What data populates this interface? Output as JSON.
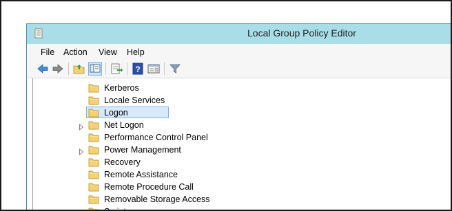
{
  "window": {
    "title": "Local Group Policy Editor"
  },
  "menu": {
    "items": [
      "File",
      "Action",
      "View",
      "Help"
    ]
  },
  "toolbar": {
    "buttons": [
      "back-icon",
      "forward-icon",
      "up-folder-icon",
      "show-hide-tree-icon",
      "export-list-icon",
      "help-icon",
      "properties-view-icon",
      "filter-icon"
    ]
  },
  "tree": {
    "items": [
      {
        "label": "Kerberos",
        "expandable": false,
        "selected": false
      },
      {
        "label": "Locale Services",
        "expandable": false,
        "selected": false
      },
      {
        "label": "Logon",
        "expandable": false,
        "selected": true
      },
      {
        "label": "Net Logon",
        "expandable": true,
        "selected": false
      },
      {
        "label": "Performance Control Panel",
        "expandable": false,
        "selected": false
      },
      {
        "label": "Power Management",
        "expandable": true,
        "selected": false
      },
      {
        "label": "Recovery",
        "expandable": false,
        "selected": false
      },
      {
        "label": "Remote Assistance",
        "expandable": false,
        "selected": false
      },
      {
        "label": "Remote Procedure Call",
        "expandable": false,
        "selected": false
      },
      {
        "label": "Removable Storage Access",
        "expandable": false,
        "selected": false
      },
      {
        "label": "Scripts",
        "expandable": false,
        "selected": false
      }
    ]
  },
  "colors": {
    "titlebar": "#a9dde8",
    "selection": "#d7e9fb",
    "selection_border": "#7eb4ea",
    "folder": "#f2d274"
  }
}
